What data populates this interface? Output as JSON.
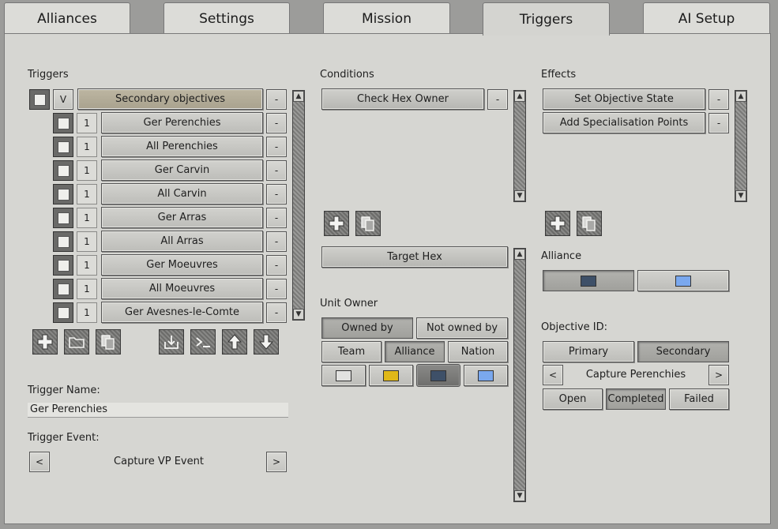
{
  "tabs": [
    {
      "label": "Alliances"
    },
    {
      "label": "Settings"
    },
    {
      "label": "Mission"
    },
    {
      "label": "Triggers"
    },
    {
      "label": "AI Setup"
    }
  ],
  "active_tab": "Triggers",
  "triggers": {
    "heading": "Triggers",
    "group": {
      "toggle": "V",
      "label": "Secondary objectives",
      "remove": "-"
    },
    "items": [
      {
        "count": "1",
        "label": "Ger Perenchies",
        "remove": "-"
      },
      {
        "count": "1",
        "label": "All Perenchies",
        "remove": "-"
      },
      {
        "count": "1",
        "label": "Ger Carvin",
        "remove": "-"
      },
      {
        "count": "1",
        "label": "All Carvin",
        "remove": "-"
      },
      {
        "count": "1",
        "label": "Ger Arras",
        "remove": "-"
      },
      {
        "count": "1",
        "label": "All Arras",
        "remove": "-"
      },
      {
        "count": "1",
        "label": "Ger Moeuvres",
        "remove": "-"
      },
      {
        "count": "1",
        "label": "All Moeuvres",
        "remove": "-"
      },
      {
        "count": "1",
        "label": "Ger Avesnes-le-Comte",
        "remove": "-"
      }
    ],
    "name_label": "Trigger Name:",
    "name_value": "Ger Perenchies",
    "event_label": "Trigger Event:",
    "event_value": "Capture VP Event",
    "prev": "<",
    "next": ">"
  },
  "conditions": {
    "heading": "Conditions",
    "items": [
      {
        "label": "Check Hex Owner",
        "remove": "-"
      }
    ],
    "target": "Target Hex",
    "unit_owner_label": "Unit Owner",
    "owned_by": "Owned by",
    "not_owned_by": "Not owned by",
    "team": "Team",
    "alliance": "Alliance",
    "nation": "Nation",
    "colors": [
      "#e2e2e0",
      "#e0b818",
      "#3e5068",
      "#7aa8ee"
    ]
  },
  "effects": {
    "heading": "Effects",
    "items": [
      {
        "label": "Set Objective State",
        "remove": "-"
      },
      {
        "label": "Add Specialisation Points",
        "remove": "-"
      }
    ],
    "alliance_label": "Alliance",
    "alliance_colors": [
      "#3e5068",
      "#7aa8ee"
    ],
    "objective_label": "Objective ID:",
    "primary": "Primary",
    "secondary": "Secondary",
    "prev": "<",
    "objective_value": "Capture Perenchies",
    "next": ">",
    "open": "Open",
    "completed": "Completed",
    "failed": "Failed"
  }
}
